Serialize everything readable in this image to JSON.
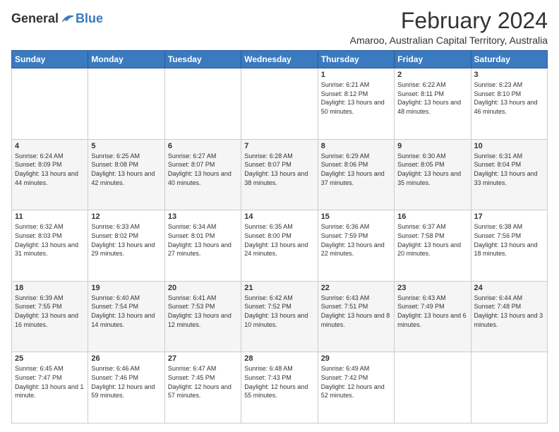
{
  "logo": {
    "general": "General",
    "blue": "Blue"
  },
  "title": "February 2024",
  "subtitle": "Amaroo, Australian Capital Territory, Australia",
  "days_header": [
    "Sunday",
    "Monday",
    "Tuesday",
    "Wednesday",
    "Thursday",
    "Friday",
    "Saturday"
  ],
  "weeks": [
    [
      {
        "day": "",
        "info": ""
      },
      {
        "day": "",
        "info": ""
      },
      {
        "day": "",
        "info": ""
      },
      {
        "day": "",
        "info": ""
      },
      {
        "day": "1",
        "info": "Sunrise: 6:21 AM\nSunset: 8:12 PM\nDaylight: 13 hours and 50 minutes."
      },
      {
        "day": "2",
        "info": "Sunrise: 6:22 AM\nSunset: 8:11 PM\nDaylight: 13 hours and 48 minutes."
      },
      {
        "day": "3",
        "info": "Sunrise: 6:23 AM\nSunset: 8:10 PM\nDaylight: 13 hours and 46 minutes."
      }
    ],
    [
      {
        "day": "4",
        "info": "Sunrise: 6:24 AM\nSunset: 8:09 PM\nDaylight: 13 hours and 44 minutes."
      },
      {
        "day": "5",
        "info": "Sunrise: 6:25 AM\nSunset: 8:08 PM\nDaylight: 13 hours and 42 minutes."
      },
      {
        "day": "6",
        "info": "Sunrise: 6:27 AM\nSunset: 8:07 PM\nDaylight: 13 hours and 40 minutes."
      },
      {
        "day": "7",
        "info": "Sunrise: 6:28 AM\nSunset: 8:07 PM\nDaylight: 13 hours and 38 minutes."
      },
      {
        "day": "8",
        "info": "Sunrise: 6:29 AM\nSunset: 8:06 PM\nDaylight: 13 hours and 37 minutes."
      },
      {
        "day": "9",
        "info": "Sunrise: 6:30 AM\nSunset: 8:05 PM\nDaylight: 13 hours and 35 minutes."
      },
      {
        "day": "10",
        "info": "Sunrise: 6:31 AM\nSunset: 8:04 PM\nDaylight: 13 hours and 33 minutes."
      }
    ],
    [
      {
        "day": "11",
        "info": "Sunrise: 6:32 AM\nSunset: 8:03 PM\nDaylight: 13 hours and 31 minutes."
      },
      {
        "day": "12",
        "info": "Sunrise: 6:33 AM\nSunset: 8:02 PM\nDaylight: 13 hours and 29 minutes."
      },
      {
        "day": "13",
        "info": "Sunrise: 6:34 AM\nSunset: 8:01 PM\nDaylight: 13 hours and 27 minutes."
      },
      {
        "day": "14",
        "info": "Sunrise: 6:35 AM\nSunset: 8:00 PM\nDaylight: 13 hours and 24 minutes."
      },
      {
        "day": "15",
        "info": "Sunrise: 6:36 AM\nSunset: 7:59 PM\nDaylight: 13 hours and 22 minutes."
      },
      {
        "day": "16",
        "info": "Sunrise: 6:37 AM\nSunset: 7:58 PM\nDaylight: 13 hours and 20 minutes."
      },
      {
        "day": "17",
        "info": "Sunrise: 6:38 AM\nSunset: 7:56 PM\nDaylight: 13 hours and 18 minutes."
      }
    ],
    [
      {
        "day": "18",
        "info": "Sunrise: 6:39 AM\nSunset: 7:55 PM\nDaylight: 13 hours and 16 minutes."
      },
      {
        "day": "19",
        "info": "Sunrise: 6:40 AM\nSunset: 7:54 PM\nDaylight: 13 hours and 14 minutes."
      },
      {
        "day": "20",
        "info": "Sunrise: 6:41 AM\nSunset: 7:53 PM\nDaylight: 13 hours and 12 minutes."
      },
      {
        "day": "21",
        "info": "Sunrise: 6:42 AM\nSunset: 7:52 PM\nDaylight: 13 hours and 10 minutes."
      },
      {
        "day": "22",
        "info": "Sunrise: 6:43 AM\nSunset: 7:51 PM\nDaylight: 13 hours and 8 minutes."
      },
      {
        "day": "23",
        "info": "Sunrise: 6:43 AM\nSunset: 7:49 PM\nDaylight: 13 hours and 6 minutes."
      },
      {
        "day": "24",
        "info": "Sunrise: 6:44 AM\nSunset: 7:48 PM\nDaylight: 13 hours and 3 minutes."
      }
    ],
    [
      {
        "day": "25",
        "info": "Sunrise: 6:45 AM\nSunset: 7:47 PM\nDaylight: 13 hours and 1 minute."
      },
      {
        "day": "26",
        "info": "Sunrise: 6:46 AM\nSunset: 7:46 PM\nDaylight: 12 hours and 59 minutes."
      },
      {
        "day": "27",
        "info": "Sunrise: 6:47 AM\nSunset: 7:45 PM\nDaylight: 12 hours and 57 minutes."
      },
      {
        "day": "28",
        "info": "Sunrise: 6:48 AM\nSunset: 7:43 PM\nDaylight: 12 hours and 55 minutes."
      },
      {
        "day": "29",
        "info": "Sunrise: 6:49 AM\nSunset: 7:42 PM\nDaylight: 12 hours and 52 minutes."
      },
      {
        "day": "",
        "info": ""
      },
      {
        "day": "",
        "info": ""
      }
    ]
  ]
}
